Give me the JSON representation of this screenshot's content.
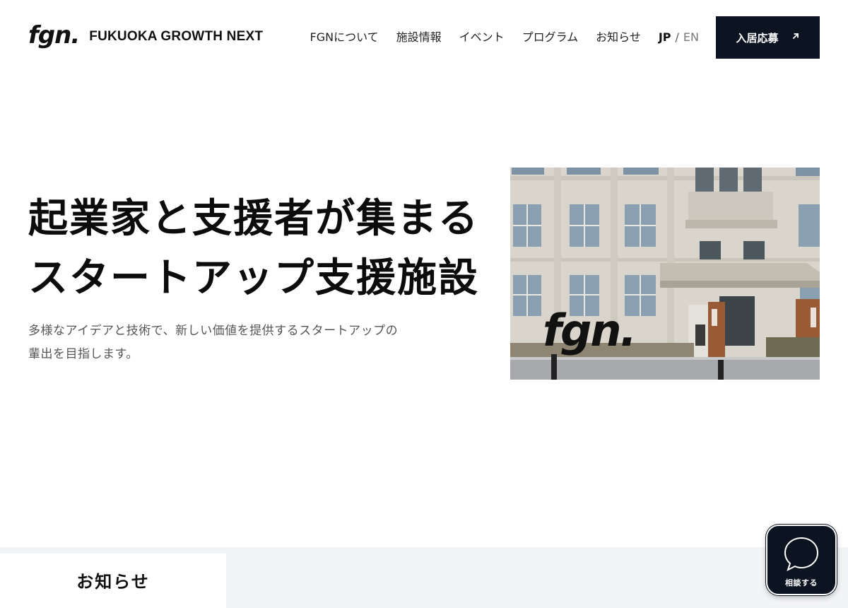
{
  "header": {
    "logo_mark": "fgn.",
    "logo_text": "FUKUOKA GROWTH NEXT",
    "nav": [
      {
        "label": "FGNについて"
      },
      {
        "label": "施設情報"
      },
      {
        "label": "イベント"
      },
      {
        "label": "プログラム"
      },
      {
        "label": "お知らせ"
      }
    ],
    "lang": {
      "jp": "JP",
      "separator": "/",
      "en": "EN"
    },
    "apply_label": "入居応募",
    "apply_icon": "arrow-up-right-icon"
  },
  "hero": {
    "title_line1": "起業家と支援者が集まる",
    "title_line2": "スタートアップ支援施設",
    "description_line1": "多様なアイデアと技術で、新しい価値を提供するスタートアップの",
    "description_line2": "輩出を目指します。",
    "photo_sign": "fgn."
  },
  "bottom": {
    "tab_label": "お知らせ"
  },
  "consult": {
    "label": "相談する",
    "icon": "chat-bubble-icon"
  },
  "colors": {
    "primary_dark": "#0b1420",
    "background": "#ffffff",
    "band": "#f3f4f7",
    "text": "#111111",
    "muted": "#555555"
  }
}
